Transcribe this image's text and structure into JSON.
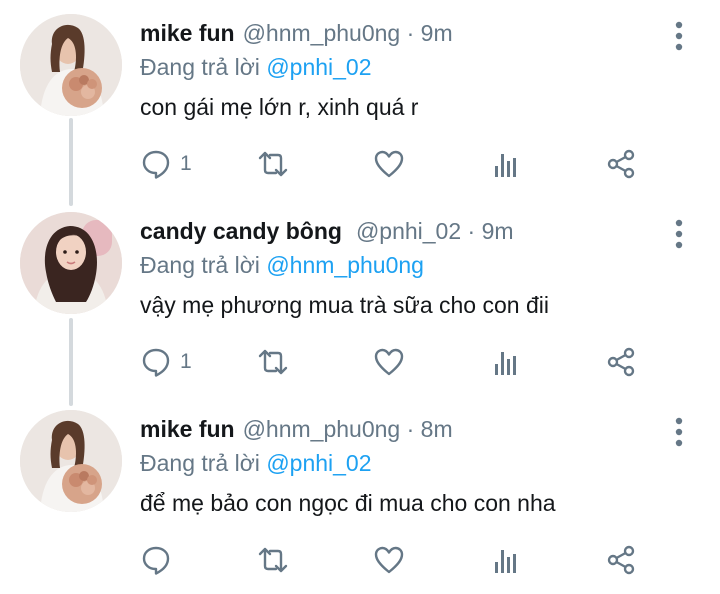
{
  "tweets": [
    {
      "name": "mike fun",
      "handle": "@hnm_phu0ng",
      "dot": "·",
      "time": "9m",
      "reply_prefix": "Đang trả lời",
      "reply_to": "@pnhi_02",
      "text": "con gái mẹ lớn r, xinh quá r",
      "reply_count": "1"
    },
    {
      "name": "candy candy bông",
      "handle": "@pnhi_02",
      "dot": "·",
      "time": "9m",
      "reply_prefix": "Đang trả lời",
      "reply_to": "@hnm_phu0ng",
      "text": "vậy mẹ phương mua trà sữa cho con đii",
      "reply_count": "1"
    },
    {
      "name": "mike fun",
      "handle": "@hnm_phu0ng",
      "dot": "·",
      "time": "8m",
      "reply_prefix": "Đang trả lời",
      "reply_to": "@pnhi_02",
      "text": "để mẹ bảo con ngọc đi mua cho con nha",
      "reply_count": ""
    }
  ],
  "icons": {
    "reply": "reply-icon",
    "retweet": "retweet-icon",
    "like": "heart-icon",
    "stats": "analytics-icon",
    "share": "share-icon",
    "more": "more-vertical-icon"
  },
  "colors": {
    "text": "#14171a",
    "muted": "#657786",
    "link": "#1da1f2",
    "thread_line": "#d4d9dd"
  }
}
